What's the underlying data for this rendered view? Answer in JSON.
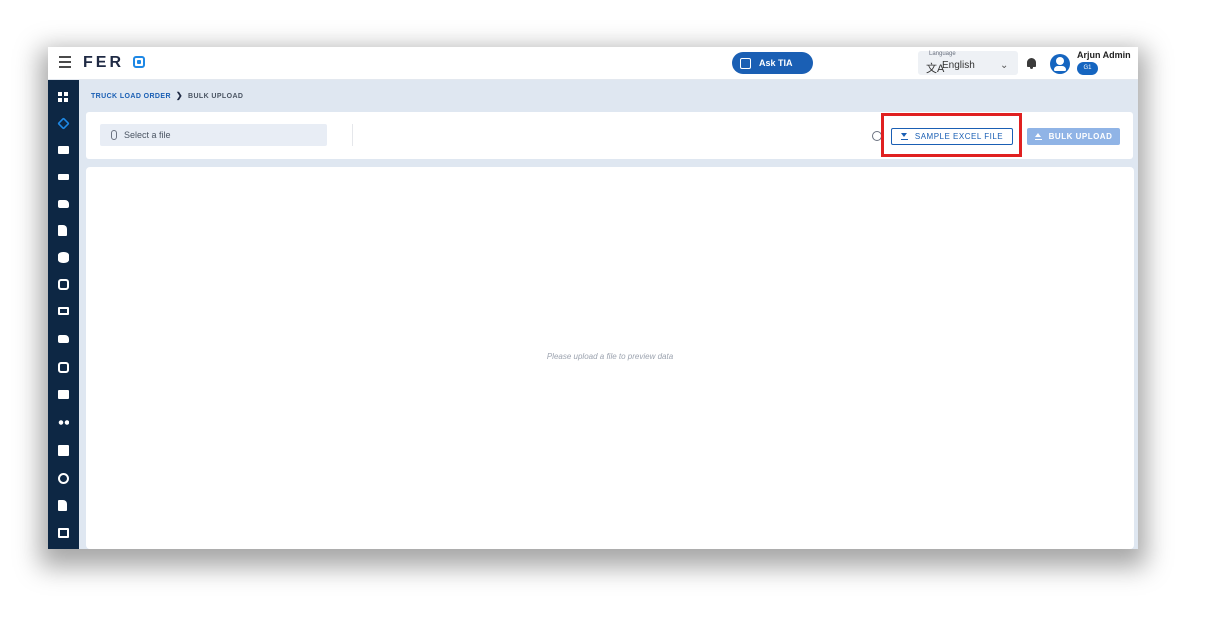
{
  "header": {
    "brand": "FER",
    "ask_button": "Ask TIA",
    "language": {
      "caption": "Language",
      "glyph": "文A",
      "value": "English",
      "chevron": "⌄"
    },
    "user": {
      "name": "Arjun Admin",
      "badge": "G1"
    }
  },
  "sidebar": {
    "items": [
      {
        "icon": "dashboard-grid-icon"
      },
      {
        "icon": "cube-icon",
        "active": true
      },
      {
        "icon": "desk-icon"
      },
      {
        "icon": "ruler-icon"
      },
      {
        "icon": "truck-icon"
      },
      {
        "icon": "document-icon"
      },
      {
        "icon": "database-icon"
      },
      {
        "icon": "vehicle-search-icon"
      },
      {
        "icon": "cash-icon"
      },
      {
        "icon": "delivery-truck-icon"
      },
      {
        "icon": "building-icon"
      },
      {
        "icon": "warehouse-icon"
      },
      {
        "icon": "people-icon"
      },
      {
        "icon": "settings-truck-icon"
      },
      {
        "icon": "gear-icon"
      },
      {
        "icon": "report-icon"
      },
      {
        "icon": "archive-icon"
      }
    ]
  },
  "breadcrumb": {
    "root": "TRUCK LOAD ORDER",
    "separator": "❯",
    "current": "BULK UPLOAD"
  },
  "toolbar": {
    "file_placeholder": "Select a file",
    "sample_button": "SAMPLE EXCEL FILE",
    "bulk_button": "BULK UPLOAD"
  },
  "preview": {
    "empty_message": "Please upload a file to preview data"
  },
  "colors": {
    "primary": "#1a5fb4",
    "sidebar": "#0d2744",
    "highlight": "#e02020",
    "disabled_button": "#90b4e6"
  }
}
